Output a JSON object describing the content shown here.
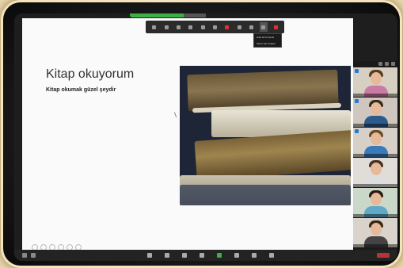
{
  "slide": {
    "title": "Kitap okuyorum",
    "subtitle": "Kitap okumak güzel şeydir"
  },
  "toolbar": {
    "buttons": [
      "mute-icon",
      "video-icon",
      "security-icon",
      "participants-icon",
      "chat-icon",
      "share-icon",
      "record-icon",
      "reactions-icon",
      "more-icon",
      "stop-icon"
    ]
  },
  "dropdown": {
    "items": [
      "Hide All Controls",
      "Show Top Toolbar"
    ]
  },
  "panel": {
    "tile_count": 6
  },
  "colors": {
    "share_bar": "#3cb043",
    "badge": "#1e7bd6",
    "stop": "#d33"
  }
}
